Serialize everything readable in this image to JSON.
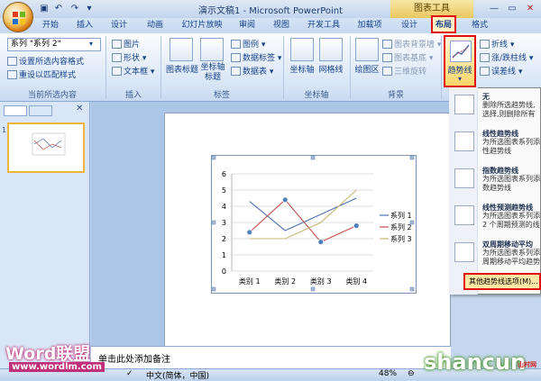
{
  "window": {
    "title": "演示文稿1 - Microsoft PowerPoint",
    "context_tab_title": "图表工具"
  },
  "tabs": [
    "开始",
    "插入",
    "设计",
    "动画",
    "幻灯片放映",
    "审阅",
    "视图",
    "开发工具",
    "加载项",
    "设计",
    "布局",
    "格式"
  ],
  "active_tab": "布局",
  "ribbon": {
    "current_selection": {
      "selected": "系列 \"系列 2\"",
      "format_selection": "设置所选内容格式",
      "reset_style": "重设以匹配样式",
      "group": "当前所选内容"
    },
    "insert": {
      "picture": "图片",
      "shapes": "形状",
      "textbox": "文本框",
      "group": "插入"
    },
    "labels": {
      "chart_title": "图表标题",
      "axis_titles": "坐标轴\n标题",
      "legend": "图例",
      "data_labels": "数据标签",
      "data_table": "数据表",
      "group": "标签"
    },
    "axes": {
      "axes": "坐标轴",
      "gridlines": "网格线",
      "group": "坐标轴"
    },
    "background": {
      "plot_area": "绘图区",
      "chart_wall": "图表背景墙",
      "chart_floor": "图表基底",
      "rotation": "三维旋转",
      "group": "背景"
    },
    "analysis": {
      "trendline": "趋势线",
      "lines": "折线",
      "updown_bars": "涨/跌柱线",
      "error_bars": "误差线"
    }
  },
  "trendline_menu": [
    {
      "title": "无",
      "desc": "删除所选趋势线,\n选择,则删除所有"
    },
    {
      "title": "线性趋势线",
      "desc": "为所选图表系列添\n性趋势线"
    },
    {
      "title": "指数趋势线",
      "desc": "为所选图表系列添\n数趋势线"
    },
    {
      "title": "线性预测趋势线",
      "desc": "为所选图表系列添\n2 个周期预测的线"
    },
    {
      "title": "双周期移动平均",
      "desc": "为所选图表系列添\n周期移动平均趋势"
    }
  ],
  "more_options": "其他趋势线选项(M)...",
  "notes_placeholder": "单击此处添加备注",
  "status": {
    "language": "中文(简体，中国)",
    "zoom": "48%"
  },
  "watermarks": {
    "left_brand": "Word联盟",
    "left_url": "www.wordlm.com",
    "right_brand": "shancun",
    "right_small": "山村网"
  },
  "chart_data": {
    "type": "line",
    "categories": [
      "类别 1",
      "类别 2",
      "类别 3",
      "类别 4"
    ],
    "ylim": [
      0,
      6
    ],
    "yticks": [
      0,
      1,
      2,
      3,
      4,
      5,
      6
    ],
    "series": [
      {
        "name": "系列 1",
        "values": [
          4.3,
          2.5,
          3.5,
          4.5
        ],
        "color": "#4f6fb3"
      },
      {
        "name": "系列 2",
        "values": [
          2.4,
          4.4,
          1.8,
          2.8
        ],
        "color": "#c0504d",
        "marker": true
      },
      {
        "name": "系列 3",
        "values": [
          2,
          2,
          3,
          5
        ],
        "color": "#c4b774"
      }
    ],
    "legend": "right"
  }
}
